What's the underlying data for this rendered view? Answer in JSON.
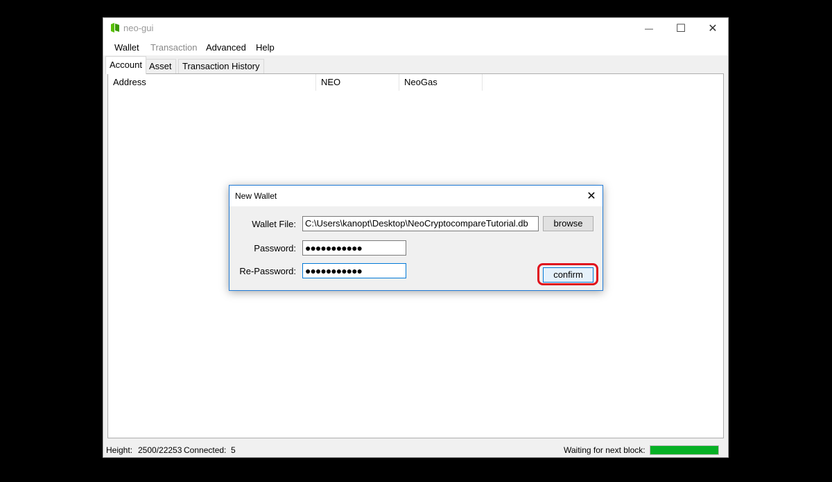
{
  "window": {
    "title": "neo-gui",
    "controls": {
      "minimize": "—",
      "maximize": "☐",
      "close": "✕"
    }
  },
  "menu": {
    "items": [
      "Wallet",
      "Transaction",
      "Advanced",
      "Help"
    ]
  },
  "tabs": [
    "Account",
    "Asset",
    "Transaction History"
  ],
  "table": {
    "columns": [
      "Address",
      "NEO",
      "NeoGas"
    ]
  },
  "status": {
    "height_label": "Height:",
    "height_value": "2500/22253",
    "connected_label": "Connected:",
    "connected_value": "5",
    "waiting_label": "Waiting for next block:",
    "progress": 1.0
  },
  "dialog": {
    "title": "New Wallet",
    "close": "✕",
    "wallet_file_label": "Wallet File:",
    "wallet_file_value": "C:\\Users\\kanopt\\Desktop\\NeoCryptocompareTutorial.db",
    "browse_label": "browse",
    "password_label": "Password:",
    "password_value": "●●●●●●●●●●●",
    "repassword_label": "Re-Password:",
    "repassword_value": "●●●●●●●●●●●",
    "confirm_label": "confirm"
  },
  "colors": {
    "accent": "#0078d7",
    "highlight": "#e0101c",
    "progress": "#06b025",
    "neo_green": "#58bf00"
  }
}
